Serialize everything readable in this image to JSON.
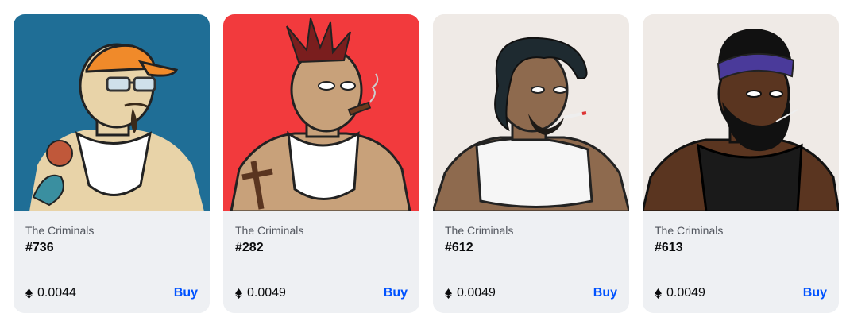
{
  "cards": [
    {
      "collection": "The Criminals",
      "token": "#736",
      "price": "0.0044",
      "buy_label": "Buy",
      "bg": "#1f6e96",
      "skin": "#e8d3a8",
      "hair": "#3a2a1a",
      "hat": "#f08a2a",
      "shirt": "#ffffff"
    },
    {
      "collection": "The Criminals",
      "token": "#282",
      "price": "0.0049",
      "buy_label": "Buy",
      "bg": "#f23a3d",
      "skin": "#c8a17a",
      "hair": "#7a1e1e",
      "hat": "",
      "shirt": "#ffffff"
    },
    {
      "collection": "The Criminals",
      "token": "#612",
      "price": "0.0049",
      "buy_label": "Buy",
      "bg": "#efeae6",
      "skin": "#8e6a4e",
      "hair": "#1e2a30",
      "hat": "",
      "shirt": "#f6f6f6"
    },
    {
      "collection": "The Criminals",
      "token": "#613",
      "price": "0.0049",
      "buy_label": "Buy",
      "bg": "#efeae6",
      "skin": "#5a3520",
      "hair": "#111111",
      "hat": "#4a3a9a",
      "shirt": "#1a1a1a"
    }
  ],
  "icons": {
    "currency": "ethereum-icon"
  },
  "colors": {
    "accent": "#0052ff",
    "card_bg": "#eef0f3"
  }
}
